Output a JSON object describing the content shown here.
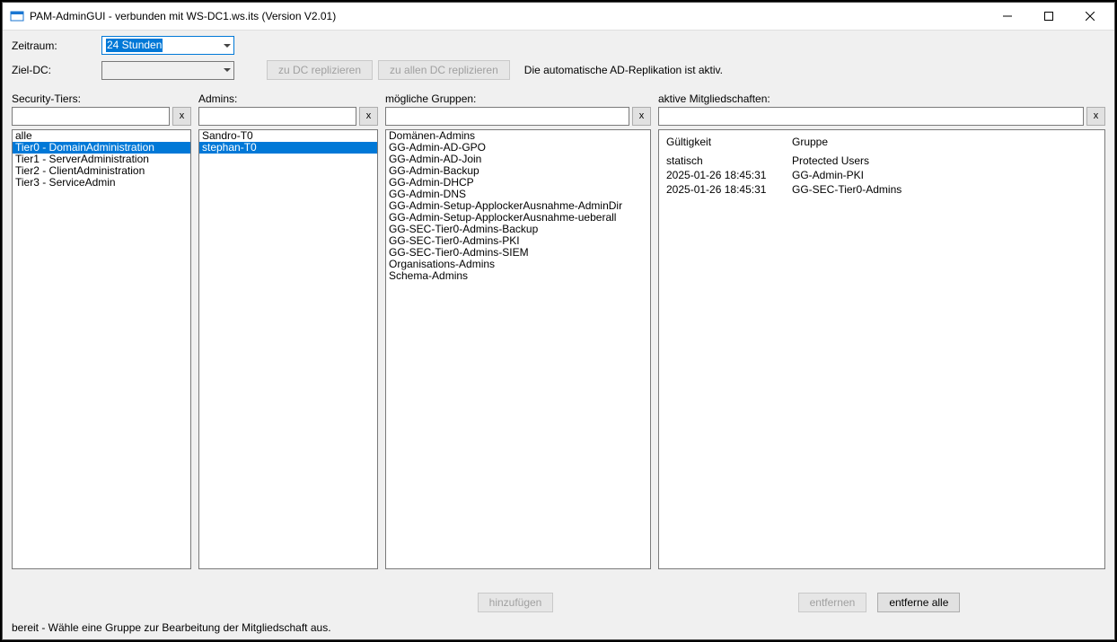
{
  "window": {
    "title": "PAM-AdminGUI - verbunden mit WS-DC1.ws.its (Version V2.01)"
  },
  "toolbar": {
    "zeitraum_label": "Zeitraum:",
    "zeitraum_value": "24 Stunden",
    "zieldc_label": "Ziel-DC:",
    "zieldc_value": "",
    "btn_replicate_one": "zu DC replizieren",
    "btn_replicate_all": "zu allen DC replizieren",
    "repl_status": "Die automatische AD-Replikation ist aktiv."
  },
  "headers": {
    "tiers": "Security-Tiers:",
    "admins": "Admins:",
    "groups": "mögliche Gruppen:",
    "active": "aktive Mitgliedschaften:"
  },
  "filters": {
    "tiers": "",
    "admins": "",
    "groups": "",
    "active": "",
    "clear_label": "x"
  },
  "tiers": {
    "items": [
      {
        "label": "alle",
        "selected": false
      },
      {
        "label": "Tier0 - DomainAdministration",
        "selected": true
      },
      {
        "label": "Tier1 - ServerAdministration",
        "selected": false
      },
      {
        "label": "Tier2 - ClientAdministration",
        "selected": false
      },
      {
        "label": "Tier3 - ServiceAdmin",
        "selected": false
      }
    ]
  },
  "admins": {
    "items": [
      {
        "label": "Sandro-T0",
        "selected": false
      },
      {
        "label": "stephan-T0",
        "selected": true
      }
    ]
  },
  "groups": {
    "items": [
      {
        "label": "Domänen-Admins"
      },
      {
        "label": "GG-Admin-AD-GPO"
      },
      {
        "label": "GG-Admin-AD-Join"
      },
      {
        "label": "GG-Admin-Backup"
      },
      {
        "label": "GG-Admin-DHCP"
      },
      {
        "label": "GG-Admin-DNS"
      },
      {
        "label": "GG-Admin-Setup-ApplockerAusnahme-AdminDir"
      },
      {
        "label": "GG-Admin-Setup-ApplockerAusnahme-ueberall"
      },
      {
        "label": "GG-SEC-Tier0-Admins-Backup"
      },
      {
        "label": "GG-SEC-Tier0-Admins-PKI"
      },
      {
        "label": "GG-SEC-Tier0-Admins-SIEM"
      },
      {
        "label": "Organisations-Admins"
      },
      {
        "label": "Schema-Admins"
      }
    ]
  },
  "memberships": {
    "col_validity": "Gültigkeit",
    "col_group": "Gruppe",
    "rows": [
      {
        "validity": "statisch",
        "group": "Protected Users"
      },
      {
        "validity": "2025-01-26 18:45:31",
        "group": "GG-Admin-PKI"
      },
      {
        "validity": "2025-01-26 18:45:31",
        "group": "GG-SEC-Tier0-Admins"
      }
    ]
  },
  "actions": {
    "add": "hinzufügen",
    "remove": "entfernen",
    "remove_all": "entferne alle"
  },
  "statusbar": "bereit - Wähle eine Gruppe zur Bearbeitung der Mitgliedschaft aus."
}
